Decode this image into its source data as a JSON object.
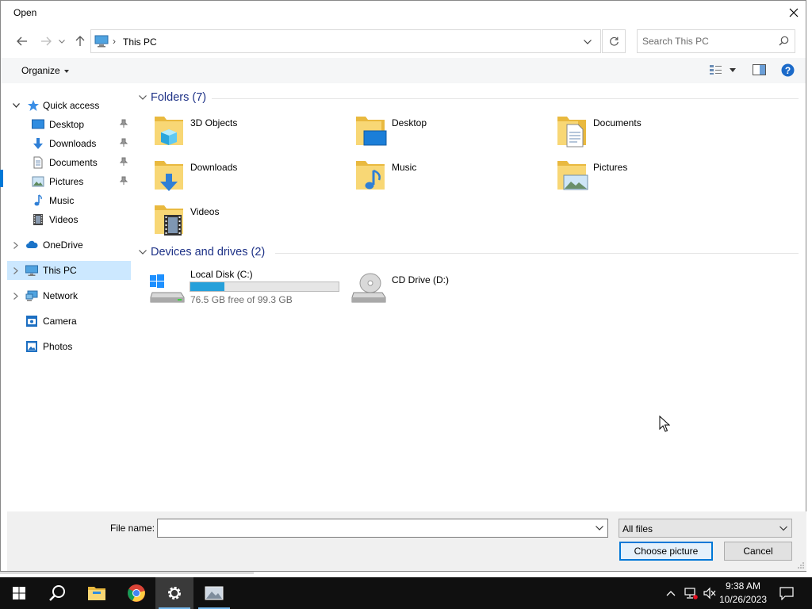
{
  "window": {
    "title": "Open"
  },
  "address": {
    "crumb": "This PC"
  },
  "search": {
    "placeholder": "Search This PC"
  },
  "toolbar": {
    "organize_label": "Organize"
  },
  "nav": {
    "quick_access": "Quick access",
    "items": [
      {
        "label": "Desktop",
        "icon": "desktop-icon",
        "pinned": true
      },
      {
        "label": "Downloads",
        "icon": "downloads-icon",
        "pinned": true
      },
      {
        "label": "Documents",
        "icon": "documents-icon",
        "pinned": true
      },
      {
        "label": "Pictures",
        "icon": "pictures-icon",
        "pinned": true
      },
      {
        "label": "Music",
        "icon": "music-icon",
        "pinned": false
      },
      {
        "label": "Videos",
        "icon": "videos-icon",
        "pinned": false
      }
    ],
    "onedrive": "OneDrive",
    "this_pc": "This PC",
    "network": "Network",
    "camera": "Camera",
    "photos": "Photos"
  },
  "content": {
    "folders_header": "Folders (7)",
    "folders": [
      {
        "label": "3D Objects",
        "icon": "3d-objects-folder-icon"
      },
      {
        "label": "Desktop",
        "icon": "desktop-folder-icon"
      },
      {
        "label": "Documents",
        "icon": "documents-folder-icon"
      },
      {
        "label": "Downloads",
        "icon": "downloads-folder-icon"
      },
      {
        "label": "Music",
        "icon": "music-folder-icon"
      },
      {
        "label": "Pictures",
        "icon": "pictures-folder-icon"
      },
      {
        "label": "Videos",
        "icon": "videos-folder-icon"
      }
    ],
    "drives_header": "Devices and drives (2)",
    "drives": [
      {
        "label": "Local Disk (C:)",
        "free_text": "76.5 GB free of 99.3 GB",
        "used_fraction": 0.23
      },
      {
        "label": "CD Drive (D:)"
      }
    ]
  },
  "bottom": {
    "file_name_label": "File name:",
    "file_name_value": "",
    "file_type": "All files",
    "primary_button": "Choose picture",
    "cancel_button": "Cancel"
  },
  "taskbar": {
    "time": "9:38 AM",
    "date": "10/26/2023"
  },
  "colors": {
    "accent": "#0078d7",
    "selection": "#cce8ff",
    "group_header": "#1e3287",
    "folder_yellow": "#f8d775",
    "drive_bar": "#26a0da"
  }
}
